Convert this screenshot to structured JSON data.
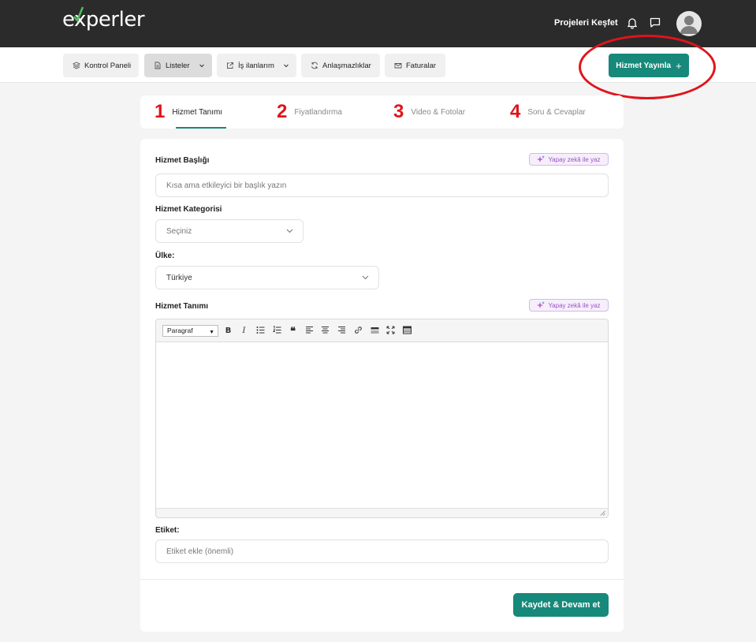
{
  "header": {
    "logo_text": "experler",
    "explore_link": "Projeleri Keşfet"
  },
  "nav": {
    "items": [
      {
        "label": "Kontrol Paneli",
        "icon": "layers-icon"
      },
      {
        "label": "Listeler",
        "icon": "document-icon"
      },
      {
        "label": "İş ilanlarım",
        "icon": "external-link-icon"
      },
      {
        "label": "Anlaşmazlıklar",
        "icon": "refresh-icon"
      },
      {
        "label": "Faturalar",
        "icon": "mail-icon"
      }
    ],
    "publish_label": "Hizmet Yayınla",
    "publish_plus": "+"
  },
  "steps": [
    {
      "num": "1",
      "label": "Hizmet Tanımı"
    },
    {
      "num": "2",
      "label": "Fiyatlandırma"
    },
    {
      "num": "3",
      "label": "Video & Fotolar"
    },
    {
      "num": "4",
      "label": "Soru & Cevaplar"
    }
  ],
  "form": {
    "title_label": "Hizmet Başlığı",
    "ai_label": "Yapay zekâ ile yaz",
    "title_placeholder": "Kısa ama etkileyici bir başlık yazın",
    "category_label": "Hizmet Kategorisi",
    "category_value": "Seçiniz",
    "country_label": "Ülke:",
    "country_value": "Türkiye",
    "description_label": "Hizmet Tanımı",
    "ai_label_2": "Yapay zekâ ile yaz",
    "editor_format": "Paragraf",
    "tags_label": "Etiket:",
    "tags_placeholder": "Etiket ekle (önemli)",
    "save_label": "Kaydet & Devam et"
  },
  "colors": {
    "accent": "#16897a",
    "topbar": "#2b2b2b",
    "annotation_red": "#e0141b",
    "ai_purple": "#9a52c8"
  }
}
